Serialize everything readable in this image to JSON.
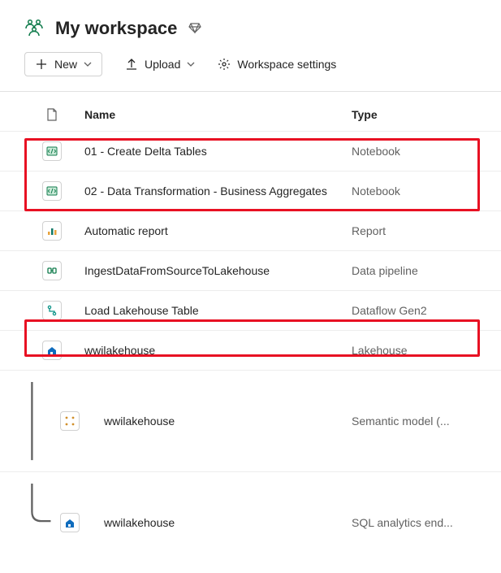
{
  "header": {
    "title": "My workspace"
  },
  "toolbar": {
    "new_label": "New",
    "upload_label": "Upload",
    "settings_label": "Workspace settings"
  },
  "columns": {
    "name": "Name",
    "type": "Type"
  },
  "items": [
    {
      "name": "01 - Create Delta Tables",
      "type": "Notebook",
      "icon": "notebook"
    },
    {
      "name": "02 - Data Transformation - Business Aggregates",
      "type": "Notebook",
      "icon": "notebook"
    },
    {
      "name": "Automatic report",
      "type": "Report",
      "icon": "report"
    },
    {
      "name": "IngestDataFromSourceToLakehouse",
      "type": "Data pipeline",
      "icon": "pipeline"
    },
    {
      "name": "Load Lakehouse Table",
      "type": "Dataflow Gen2",
      "icon": "dataflow"
    },
    {
      "name": "wwilakehouse",
      "type": "Lakehouse",
      "icon": "lakehouse"
    }
  ],
  "children": [
    {
      "name": "wwilakehouse",
      "type": "Semantic model (...",
      "icon": "semantic"
    },
    {
      "name": "wwilakehouse",
      "type": "SQL analytics end...",
      "icon": "sql"
    }
  ]
}
